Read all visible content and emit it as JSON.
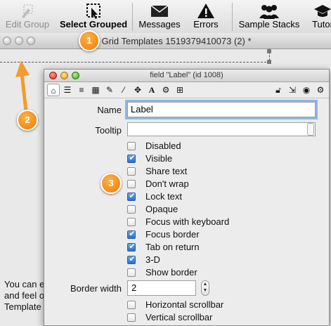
{
  "toolbar": {
    "items": [
      {
        "label": "Edit Group",
        "icon": "edit-group-icon",
        "enabled": false
      },
      {
        "label": "Select Grouped",
        "icon": "select-grouped-icon",
        "enabled": true
      },
      {
        "label": "Messages",
        "icon": "envelope-icon",
        "enabled": true
      },
      {
        "label": "Errors",
        "icon": "warning-icon",
        "enabled": true
      },
      {
        "label": "Sample Stacks",
        "icon": "people-icon",
        "enabled": true
      },
      {
        "label": "Tutor",
        "icon": "graduation-cap-icon",
        "enabled": true
      }
    ]
  },
  "stack_window": {
    "title": "Data Grid Templates 1519379410073 (2) *"
  },
  "background_text": {
    "line1": "You can e",
    "line2": "and feel o",
    "line3": "Template"
  },
  "callouts": [
    "1",
    "2",
    "3"
  ],
  "inspector": {
    "title": "field \"Label\" (id 1008)",
    "tool_icons": [
      "home-icon",
      "list-icon",
      "database-icon",
      "table-icon",
      "pencil-icon",
      "wand-icon",
      "move-icon",
      "text-icon",
      "link-icon",
      "resize-icon",
      "lock-icon",
      "import-icon",
      "target-icon",
      "gear-icon"
    ],
    "name_label": "Name",
    "name_value": "Label",
    "tooltip_label": "Tooltip",
    "tooltip_value": "",
    "checkboxes": [
      {
        "label": "Disabled",
        "checked": false
      },
      {
        "label": "Visible",
        "checked": true
      },
      {
        "label": "Share text",
        "checked": false
      },
      {
        "label": "Don't wrap",
        "checked": false
      },
      {
        "label": "Lock text",
        "checked": true
      },
      {
        "label": "Opaque",
        "checked": false
      },
      {
        "label": "Focus with keyboard",
        "checked": false
      },
      {
        "label": "Focus border",
        "checked": true
      },
      {
        "label": "Tab on return",
        "checked": true
      },
      {
        "label": "3-D",
        "checked": true
      },
      {
        "label": "Show border",
        "checked": false
      }
    ],
    "border_width_label": "Border width",
    "border_width_value": "2",
    "scroll_checkboxes": [
      {
        "label": "Horizontal scrollbar",
        "checked": false
      },
      {
        "label": "Vertical scrollbar",
        "checked": false
      }
    ]
  },
  "colors": {
    "accent": "#2b6fd1",
    "callout": "#f07800",
    "focus_ring": "#8db6e8"
  }
}
